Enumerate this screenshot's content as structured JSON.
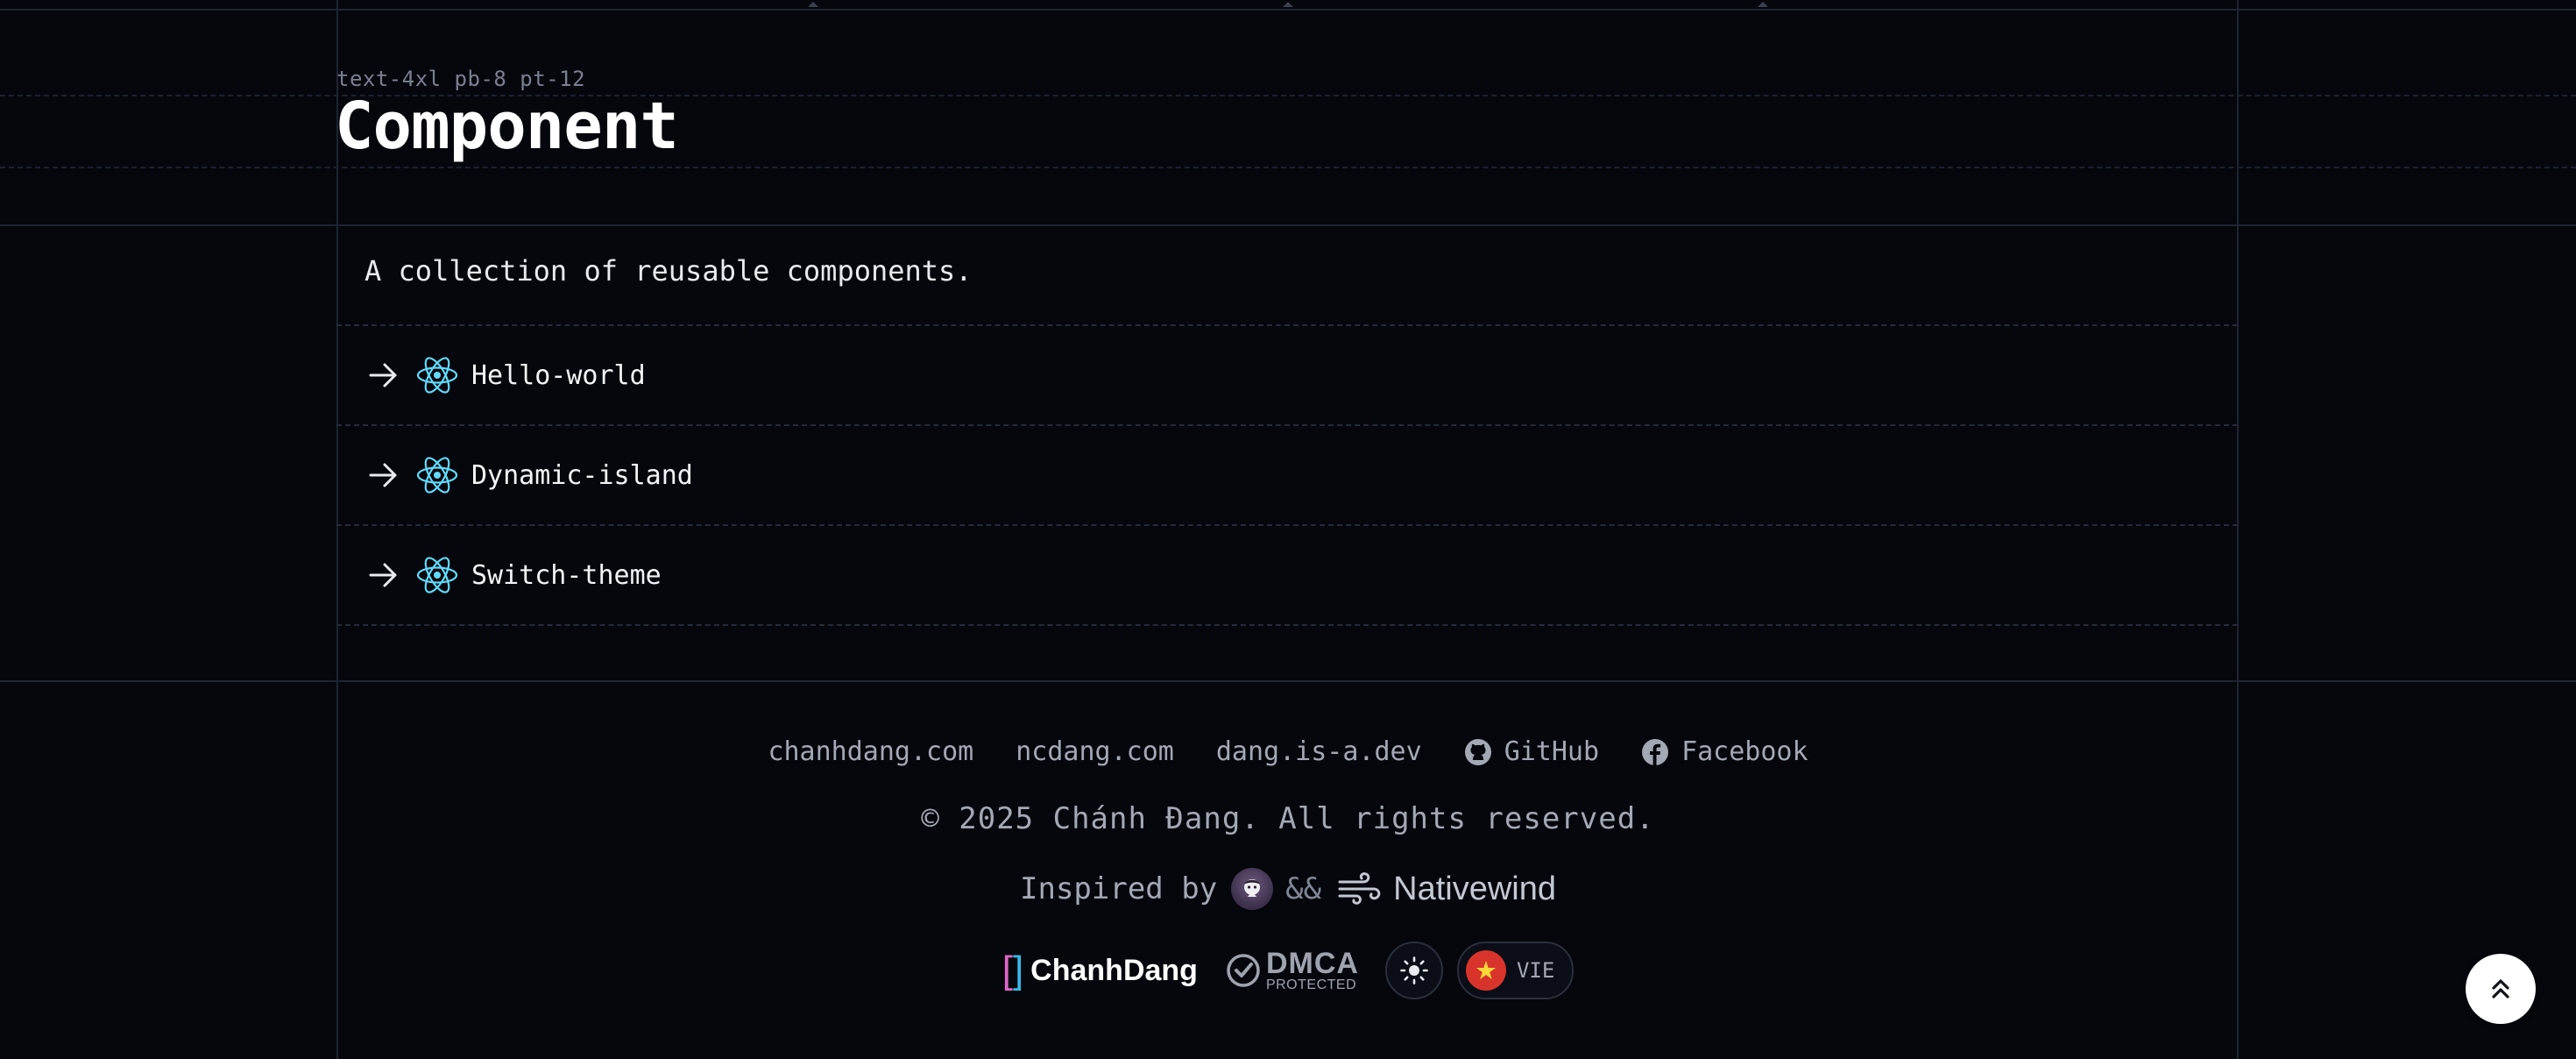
{
  "header": {
    "class_hint": "text-4xl pb-8 pt-12",
    "title": "Component"
  },
  "content": {
    "description": "A collection of reusable components.",
    "items": [
      {
        "label": "Hello-world",
        "icon": "react-icon"
      },
      {
        "label": "Dynamic-island",
        "icon": "react-icon"
      },
      {
        "label": "Switch-theme",
        "icon": "react-icon"
      }
    ]
  },
  "footer": {
    "links": [
      {
        "label": "chanhdang.com"
      },
      {
        "label": "ncdang.com"
      },
      {
        "label": "dang.is-a.dev"
      },
      {
        "label": "GitHub",
        "icon": "github-icon"
      },
      {
        "label": "Facebook",
        "icon": "facebook-icon"
      }
    ],
    "copyright": "© 2025 Chánh Đang. All rights reserved.",
    "inspired_prefix": "Inspired by",
    "inspired_amp": "&&",
    "inspired_nativewind": "Nativewind",
    "brand_left": "[",
    "brand_right": "]",
    "brand_name": "ChanhDang",
    "dmca_big": "DMCA",
    "dmca_small": "PROTECTED",
    "language_label": "VIE"
  },
  "colors": {
    "background": "#05070d",
    "react_blue": "#61dafb",
    "brand_pink": "#e066c8",
    "brand_cyan": "#39b8e8",
    "flag_red": "#d8342b",
    "flag_star": "#ffd83a"
  }
}
